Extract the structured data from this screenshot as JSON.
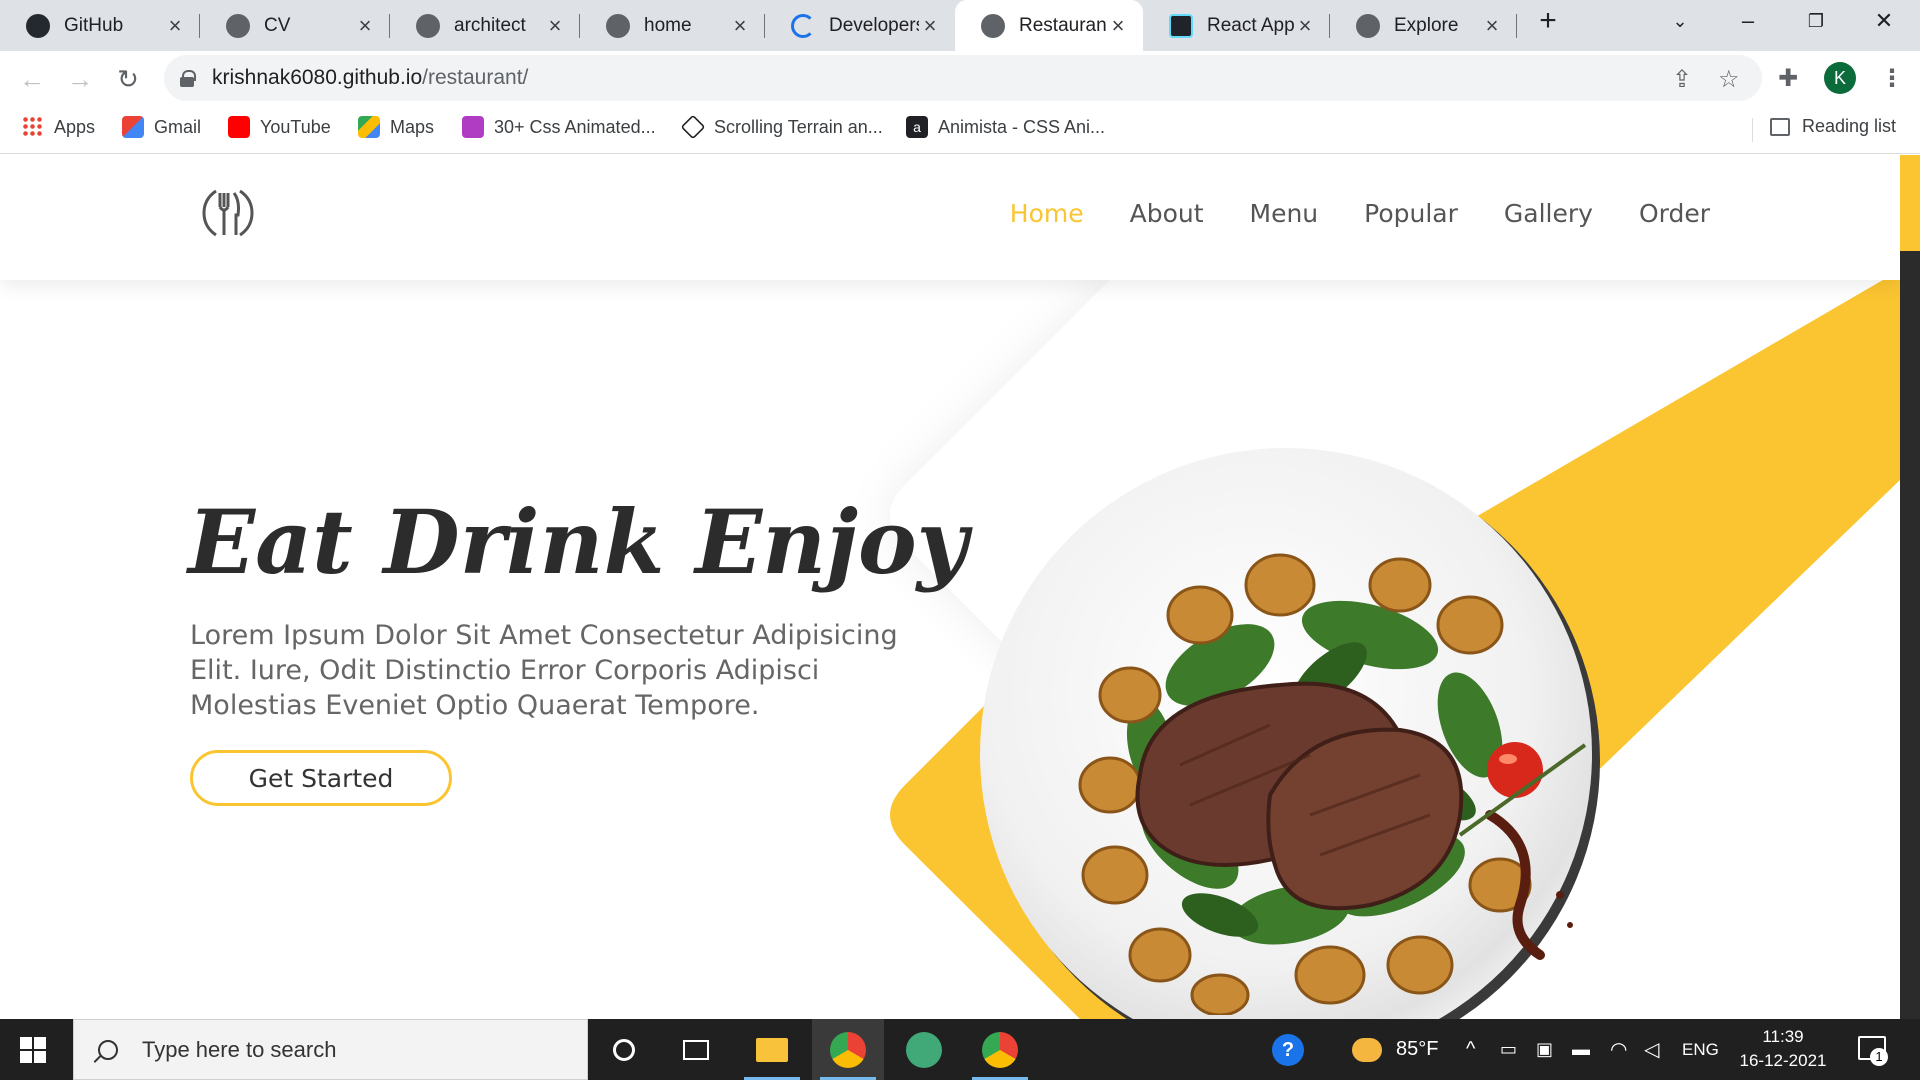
{
  "browser": {
    "tabs": [
      {
        "title": "GitHub",
        "favicon": "github-icon"
      },
      {
        "title": "CV",
        "favicon": "globe-icon"
      },
      {
        "title": "architect",
        "favicon": "globe-icon"
      },
      {
        "title": "home",
        "favicon": "globe-icon"
      },
      {
        "title": "Developers",
        "favicon": "loading-spinner-icon"
      },
      {
        "title": "Restaurant",
        "favicon": "globe-icon",
        "active": true
      },
      {
        "title": "React App",
        "favicon": "react-icon"
      },
      {
        "title": "Explore",
        "favicon": "globe-icon"
      }
    ],
    "address": {
      "host": "krishnak6080.github.io",
      "path": "/restaurant/"
    },
    "profile_initial": "K",
    "bookmarks": [
      {
        "label": "Apps",
        "icon": "apps-grid-icon"
      },
      {
        "label": "Gmail",
        "icon": "gmail-icon"
      },
      {
        "label": "YouTube",
        "icon": "youtube-icon"
      },
      {
        "label": "Maps",
        "icon": "maps-icon"
      },
      {
        "label": "30+ Css Animated...",
        "icon": "css-animated-icon"
      },
      {
        "label": "Scrolling Terrain an...",
        "icon": "codepen-icon"
      },
      {
        "label": "Animista - CSS Ani...",
        "icon": "animista-icon"
      }
    ],
    "reading_list": "Reading list"
  },
  "site": {
    "nav": [
      "Home",
      "About",
      "Menu",
      "Popular",
      "Gallery",
      "Order"
    ],
    "active_nav": "Home",
    "accent_color": "#fbc531",
    "hero": {
      "title": "Eat Drink Enjoy",
      "text": "Lorem Ipsum Dolor Sit Amet Consectetur Adipisicing Elit. Iure, Odit Distinctio Error Corporis Adipisci Molestias Eveniet Optio Quaerat Tempore.",
      "cta": "Get Started"
    }
  },
  "taskbar": {
    "search_placeholder": "Type here to search",
    "weather": "85°F",
    "language": "ENG",
    "time": "11:39",
    "date": "16-12-2021",
    "notification_count": "1"
  }
}
